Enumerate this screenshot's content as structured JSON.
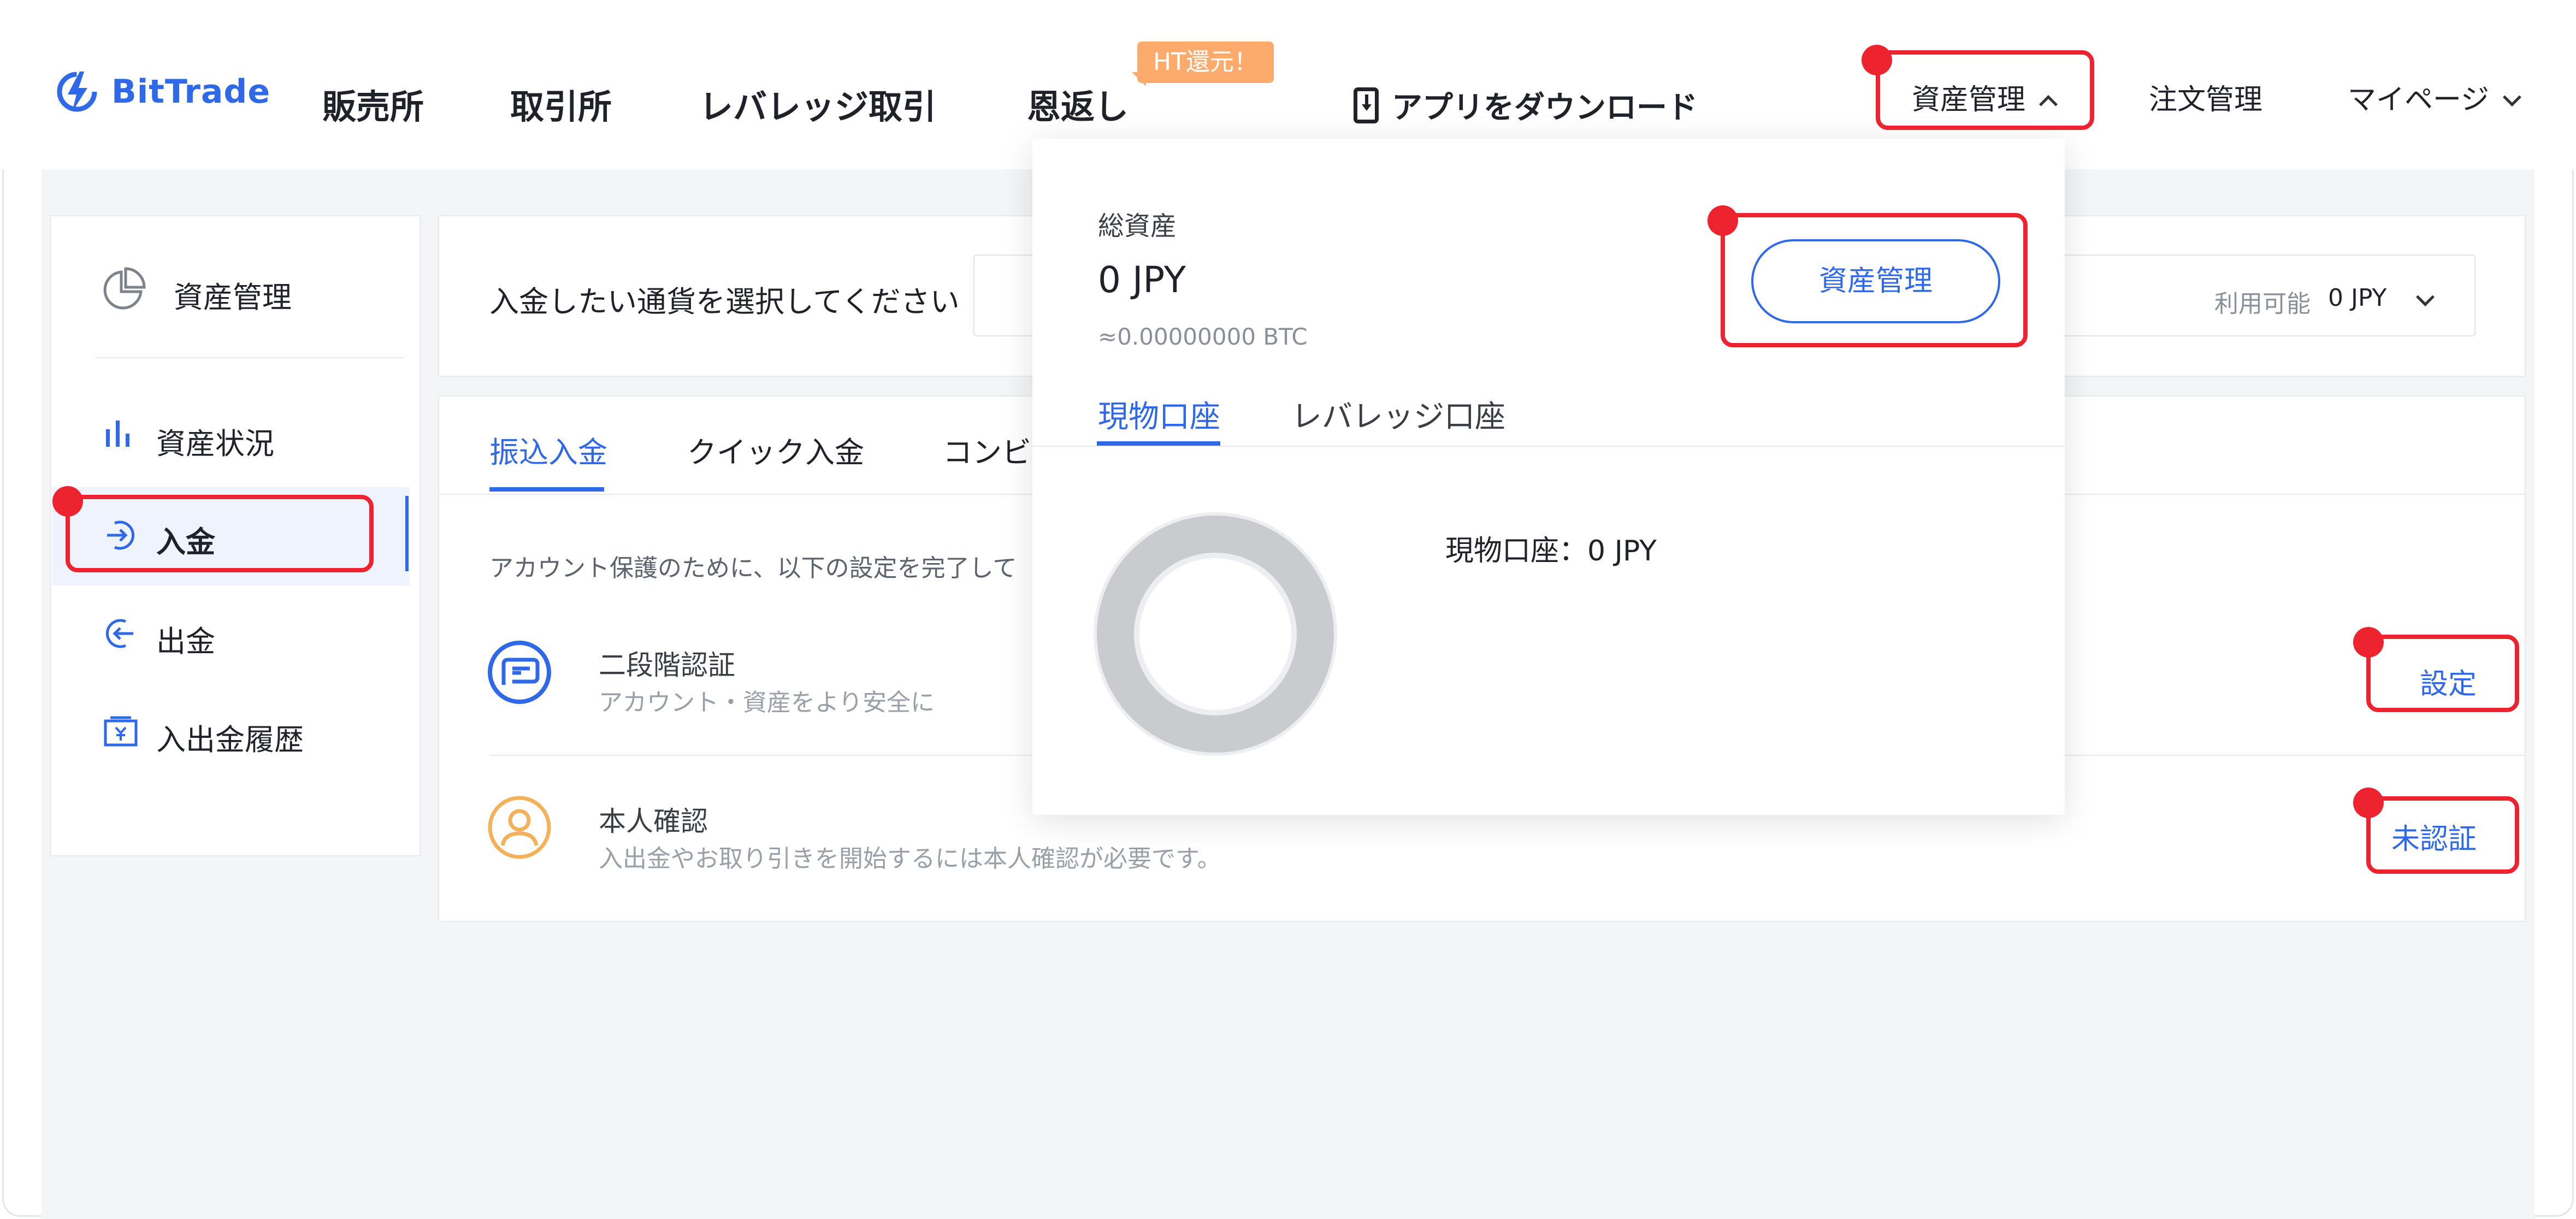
{
  "header": {
    "logo_text": "BitTrade",
    "nav": {
      "sales": "販売所",
      "exchange": "取引所",
      "leverage": "レバレッジ取引",
      "ongaeshi": "恩返し",
      "ongaeshi_badge": "HT還元！",
      "app_download": "アプリをダウンロード"
    },
    "right": {
      "asset_management": "資産管理",
      "order_management": "注文管理",
      "my_page": "マイページ"
    }
  },
  "sidebar": {
    "title": "資産管理",
    "items": [
      {
        "label": "資産状況",
        "icon": "bar-chart-icon"
      },
      {
        "label": "入金",
        "icon": "deposit-arrow-icon",
        "active": true
      },
      {
        "label": "出金",
        "icon": "withdraw-arrow-icon"
      },
      {
        "label": "入出金履歴",
        "icon": "history-icon"
      }
    ]
  },
  "currency_select": {
    "prompt": "入金したい通貨を選択してください",
    "available_label": "利用可能",
    "available_value": "0 JPY"
  },
  "deposit_tabs": {
    "tabs": [
      "振込入金",
      "クイック入金",
      "コンビ"
    ],
    "active": 0
  },
  "security": {
    "notice": "アカウント保護のために、以下の設定を完了して",
    "two_factor": {
      "title": "二段階認証",
      "subtitle": "アカウント・資産をより安全に",
      "action": "設定"
    },
    "identity": {
      "title": "本人確認",
      "subtitle": "入出金やお取り引きを開始するには本人確認が必要です。",
      "action": "未認証"
    }
  },
  "asset_dropdown": {
    "total_label": "総資産",
    "total_value": "0 JPY",
    "approx_btc": "≈0.00000000 BTC",
    "manage_button": "資産管理",
    "tabs": [
      "現物口座",
      "レバレッジ口座"
    ],
    "active_tab": 0,
    "spot_summary": "現物口座：0 JPY"
  },
  "colors": {
    "brand_blue": "#2f69e8",
    "highlight_red": "#ee2330",
    "badge_orange": "#fdab6c",
    "identity_icon": "#f3b25a"
  }
}
